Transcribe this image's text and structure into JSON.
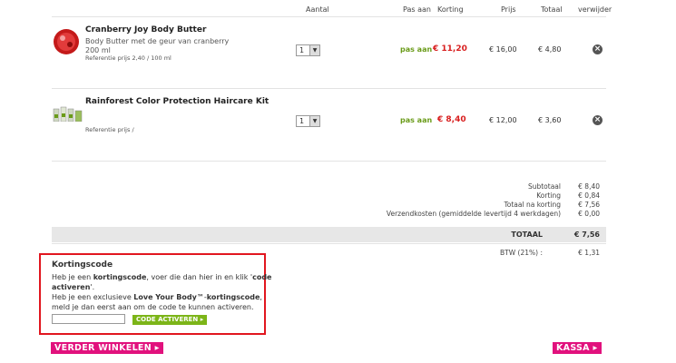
{
  "columns": {
    "aantal": "Aantal",
    "pas_aan": "Pas aan",
    "korting": "Korting",
    "prijs": "Prijs",
    "totaal": "Totaal",
    "verwijder": "verwijder"
  },
  "items": [
    {
      "name": "Cranberry Joy Body Butter",
      "desc1": "Body Butter met de geur van cranberry",
      "desc2": "200 ml",
      "ref": "Referentie prijs 2,40 / 100 ml",
      "qty": "1",
      "pas_aan": "pas aan",
      "korting": "€  11,20",
      "prijs": "€  16,00",
      "totaal": "€  4,80"
    },
    {
      "name": "Rainforest Color Protection Haircare Kit",
      "desc1": "",
      "desc2": "",
      "ref": "Referentie prijs /",
      "qty": "1",
      "pas_aan": "pas aan",
      "korting": "€  8,40",
      "prijs": "€  12,00",
      "totaal": "€  3,60"
    }
  ],
  "totals": {
    "subtotaal_label": "Subtotaal",
    "subtotaal_value": "€  8,40",
    "korting_label": "Korting",
    "korting_value": "€  0,84",
    "na_korting_label": "Totaal na korting",
    "na_korting_value": "€  7,56",
    "verzend_label": "Verzendkosten (gemiddelde levertijd 4 werkdagen)",
    "verzend_value": "€  0,00",
    "totaal_label": "TOTAAL",
    "totaal_value": "€  7,56",
    "btw_label": "BTW (21%) :",
    "btw_value": "€  1,31"
  },
  "coupon": {
    "title": "Kortingscode",
    "line1a": "Heb je een ",
    "line1b": "kortingscode",
    "line1c": ", voer die dan hier in en klik '",
    "line1d": "code",
    "line2": "activeren",
    "line2end": "'.",
    "line3a": "Heb je een exclusieve ",
    "line3b": "Love Your Body™",
    "line3c": "-",
    "line3d": "kortingscode",
    "line3e": ",",
    "line4": "meld je dan eerst aan om de code te kunnen activeren.",
    "input_value": "",
    "button": "CODE ACTIVEREN"
  },
  "buttons": {
    "verder": "VERDER WINKELEN",
    "kassa": "KASSA"
  },
  "colors": {
    "pink": "#e1117d",
    "green": "#7cb518",
    "red": "#d81e1e",
    "highlight": "#e1161f"
  }
}
